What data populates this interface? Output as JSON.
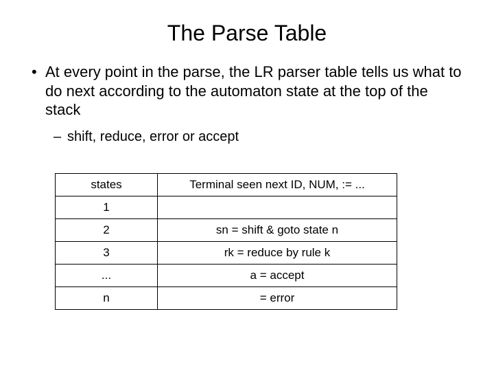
{
  "title": "The Parse Table",
  "bullets": {
    "b1": "At every point in the parse, the LR parser table tells us what to do next according to the automaton state at the top of the stack",
    "b2": "shift, reduce, error or accept"
  },
  "table": {
    "headers": {
      "states": "states",
      "terminal": "Terminal seen next ID, NUM, := ..."
    },
    "rows": [
      {
        "state": "1",
        "action": ""
      },
      {
        "state": "2",
        "action": "sn = shift & goto state n"
      },
      {
        "state": "3",
        "action": "rk = reduce by rule k"
      },
      {
        "state": "...",
        "action": "a = accept"
      },
      {
        "state": "n",
        "action": "  = error"
      }
    ]
  }
}
